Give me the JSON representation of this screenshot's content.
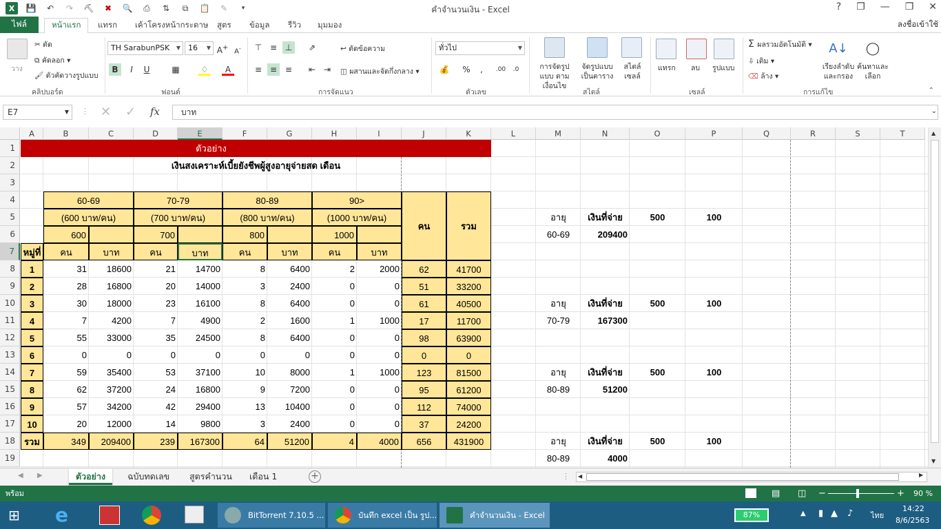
{
  "window": {
    "title": "คำจำนวนเงิน - Excel",
    "help": "?",
    "restore": "❐",
    "minimize": "—",
    "maximize": "❐",
    "close": "✕"
  },
  "ribbon_tabs": [
    "หน้าแรก",
    "แทรก",
    "เค้าโครงหน้ากระดาษ",
    "สูตร",
    "ข้อมูล",
    "รีวิว",
    "มุมมอง"
  ],
  "file_tab": "ไฟล์",
  "sign_in": "ลงชื่อเข้าใช้",
  "clipboard": {
    "paste": "วาง",
    "cut": "ตัด",
    "copy": "คัดลอก",
    "format_painter": "ตัวคัดวางรูปแบบ",
    "label": "คลิปบอร์ด"
  },
  "font": {
    "name": "TH SarabunPSK",
    "size": "16",
    "bold": "B",
    "italic": "I",
    "underline": "U",
    "label": "ฟอนต์"
  },
  "alignment": {
    "wrap_text": "ตัดข้อความ",
    "merge_center": "ผสานและจัดกึ่งกลาง",
    "label": "การจัดแนว"
  },
  "number": {
    "format": "ทั่วไป",
    "percent": "%",
    "comma": ",",
    "label": "ตัวเลข"
  },
  "styles": {
    "conditional": "การจัดรูปแบบ ตามเงื่อนไข",
    "format_table": "จัดรูปแบบ เป็นตาราง",
    "cell_styles": "สไตล์ เซลล์",
    "label": "สไตล์"
  },
  "cells": {
    "insert": "แทรก",
    "delete": "ลบ",
    "format": "รูปแบบ",
    "label": "เซลล์"
  },
  "editing": {
    "autosum": "ผลรวมอัตโนมัติ",
    "fill": "เติม",
    "clear": "ล้าง",
    "sort_filter": "เรียงลำดับ และกรอง",
    "find_select": "ค้นหาและ เลือก",
    "label": "การแก้ไข"
  },
  "formula_bar": {
    "name_box": "E7",
    "value": "บาท",
    "fx": "fx"
  },
  "columns": [
    "A",
    "B",
    "C",
    "D",
    "E",
    "F",
    "G",
    "H",
    "I",
    "J",
    "K",
    "L",
    "M",
    "N",
    "O",
    "P",
    "Q",
    "R",
    "S",
    "T"
  ],
  "rows": [
    "1",
    "2",
    "3",
    "4",
    "5",
    "6",
    "7",
    "8",
    "9",
    "10",
    "11",
    "12",
    "13",
    "14",
    "15",
    "16",
    "17",
    "18",
    "19"
  ],
  "sheet": {
    "title": "ตัวอย่าง",
    "subtitle": "เงินสงเคราะห์เบี้ยยังชีพผู้สูงอายุจ่ายสด เดือน",
    "age_groups": [
      "60-69",
      "70-79",
      "80-89",
      "90>"
    ],
    "rates": [
      "(600 บาท/คน)",
      "(700 บาท/คน)",
      "(800 บาท/คน)",
      "(1000 บาท/คน)"
    ],
    "rate_values": [
      "600",
      "700",
      "800",
      "1000"
    ],
    "col_people": "คน",
    "col_total": "รวม",
    "village_header": "หมู่ที่",
    "sub_people": "คน",
    "sub_baht": "บาท",
    "data_rows": [
      [
        "1",
        "31",
        "18600",
        "21",
        "14700",
        "8",
        "6400",
        "2",
        "2000",
        "62",
        "41700"
      ],
      [
        "2",
        "28",
        "16800",
        "20",
        "14000",
        "3",
        "2400",
        "0",
        "0",
        "51",
        "33200"
      ],
      [
        "3",
        "30",
        "18000",
        "23",
        "16100",
        "8",
        "6400",
        "0",
        "0",
        "61",
        "40500"
      ],
      [
        "4",
        "7",
        "4200",
        "7",
        "4900",
        "2",
        "1600",
        "1",
        "1000",
        "17",
        "11700"
      ],
      [
        "5",
        "55",
        "33000",
        "35",
        "24500",
        "8",
        "6400",
        "0",
        "0",
        "98",
        "63900"
      ],
      [
        "6",
        "0",
        "0",
        "0",
        "0",
        "0",
        "0",
        "0",
        "0",
        "0",
        "0"
      ],
      [
        "7",
        "59",
        "35400",
        "53",
        "37100",
        "10",
        "8000",
        "1",
        "1000",
        "123",
        "81500"
      ],
      [
        "8",
        "62",
        "37200",
        "24",
        "16800",
        "9",
        "7200",
        "0",
        "0",
        "95",
        "61200"
      ],
      [
        "9",
        "57",
        "34200",
        "42",
        "29400",
        "13",
        "10400",
        "0",
        "0",
        "112",
        "74000"
      ],
      [
        "10",
        "20",
        "12000",
        "14",
        "9800",
        "3",
        "2400",
        "0",
        "0",
        "37",
        "24200"
      ]
    ],
    "total_row": [
      "รวม",
      "349",
      "209400",
      "239",
      "167300",
      "64",
      "51200",
      "4",
      "4000",
      "656",
      "431900"
    ],
    "side_blocks": [
      {
        "h1": "อายุ",
        "h2": "เงินที่จ่าย",
        "h3": "500",
        "h4": "100",
        "age": "60-69",
        "amount": "209400"
      },
      {
        "h1": "อายุ",
        "h2": "เงินที่จ่าย",
        "h3": "500",
        "h4": "100",
        "age": "70-79",
        "amount": "167300"
      },
      {
        "h1": "อายุ",
        "h2": "เงินที่จ่าย",
        "h3": "500",
        "h4": "100",
        "age": "80-89",
        "amount": "51200"
      },
      {
        "h1": "อายุ",
        "h2": "เงินที่จ่าย",
        "h3": "500",
        "h4": "100",
        "age": "80-89",
        "amount": "4000"
      }
    ]
  },
  "sheet_tabs": [
    "ตัวอย่าง",
    "ฉบับทดเลข",
    "สูตรคำนวน",
    "เดือน 1"
  ],
  "status": {
    "ready": "พร้อม",
    "zoom": "90 %"
  },
  "taskbar": {
    "apps": [
      "BitTorrent 7.10.5 ...",
      "บันทึก excel เป็น รูป...",
      "คำจำนวนเงิน - Excel"
    ],
    "battery": "87%",
    "lang": "ไทย",
    "time": "14:22",
    "date": "8/6/2563"
  },
  "colors": {
    "excel_green": "#217346",
    "title_red": "#c00000",
    "header_yellow": "#ffe699",
    "taskbar": "#1e5d82"
  }
}
